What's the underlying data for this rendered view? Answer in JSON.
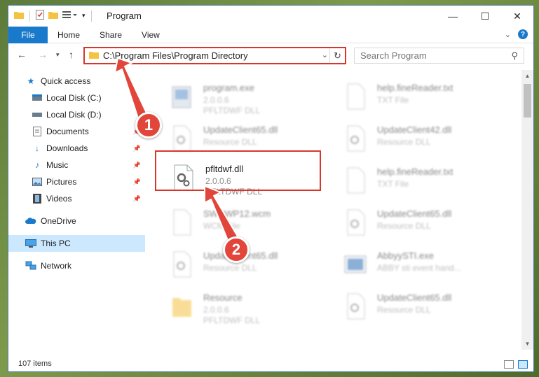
{
  "window": {
    "title": "Program",
    "minimize": "—",
    "maximize": "☐",
    "close": "✕"
  },
  "ribbon": {
    "tabs": [
      "File",
      "Home",
      "Share",
      "View"
    ]
  },
  "address": {
    "path": "C:\\Program Files\\Program Directory",
    "search_placeholder": "Search Program"
  },
  "sidebar": {
    "items": [
      {
        "label": "Quick access",
        "icon": "star-icon"
      },
      {
        "label": "Local Disk (C:)",
        "icon": "drive-icon"
      },
      {
        "label": "Local Disk (D:)",
        "icon": "drive-icon"
      },
      {
        "label": "Documents",
        "icon": "documents-icon"
      },
      {
        "label": "Downloads",
        "icon": "download-icon"
      },
      {
        "label": "Music",
        "icon": "music-icon"
      },
      {
        "label": "Pictures",
        "icon": "pictures-icon"
      },
      {
        "label": "Videos",
        "icon": "videos-icon"
      },
      {
        "label": "OneDrive",
        "icon": "cloud-icon"
      },
      {
        "label": "This PC",
        "icon": "computer-icon"
      },
      {
        "label": "Network",
        "icon": "network-icon"
      }
    ]
  },
  "files": [
    {
      "name": "program.exe",
      "line2": "2.0.0.6",
      "line3": "PFLTDWF DLL"
    },
    {
      "name": "help.fineReader.txt",
      "line2": "TXT File",
      "line3": ""
    },
    {
      "name": "UpdateClient65.dll",
      "line2": "Resource DLL",
      "line3": ""
    },
    {
      "name": "UpdateClient42.dll",
      "line2": "Resource DLL",
      "line3": ""
    },
    {
      "name": "pfltdwf.dll",
      "line2": "2.0.0.6",
      "line3": "PFLTDWF DLL"
    },
    {
      "name": "help.fineReader.txt",
      "line2": "TXT File",
      "line3": ""
    },
    {
      "name": "SWDWP12.wcm",
      "line2": "WCM File",
      "line3": ""
    },
    {
      "name": "UpdateClient65.dll",
      "line2": "Resource DLL",
      "line3": ""
    },
    {
      "name": "UpdateClient65.dll",
      "line2": "Resource DLL",
      "line3": ""
    },
    {
      "name": "AbbyySTI.exe",
      "line2": "ABBY sti event hand...",
      "line3": ""
    },
    {
      "name": "Resource",
      "line2": "2.0.0.6",
      "line3": "PFLTDWF DLL"
    },
    {
      "name": "UpdateClient65.dll",
      "line2": "Resource DLL",
      "line3": ""
    }
  ],
  "status": {
    "count": "107 items"
  },
  "annotations": {
    "step1": "1",
    "step2": "2",
    "color": "#e2453a"
  }
}
